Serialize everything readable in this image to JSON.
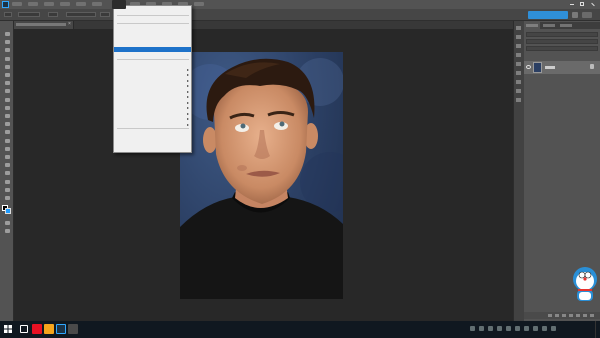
{
  "app": {
    "name": "Adobe Photoshop",
    "logo_text": "Ps",
    "accent": "#31a8ff"
  },
  "menubar": {
    "items": [
      "",
      "",
      "",
      "",
      "",
      "",
      "",
      "",
      "",
      "",
      "",
      ""
    ],
    "active_index": 6,
    "window_controls": [
      "minimize-icon",
      "maximize-icon",
      "close-icon"
    ]
  },
  "options_bar": {
    "cloud_button_label": ""
  },
  "document": {
    "tab_title": "",
    "close_glyph": "×"
  },
  "dropdown": {
    "items": [
      {
        "label": "",
        "shortcut": "",
        "submenu": false
      },
      {
        "separator": true
      },
      {
        "label": "",
        "shortcut": "",
        "submenu": false
      },
      {
        "separator": true
      },
      {
        "label": "",
        "shortcut": "",
        "submenu": false
      },
      {
        "label": "",
        "shortcut": "",
        "submenu": false
      },
      {
        "label": "",
        "shortcut": "",
        "submenu": false
      },
      {
        "label": "",
        "shortcut": "",
        "submenu": false
      },
      {
        "label": "",
        "shortcut": "",
        "submenu": false,
        "highlighted": true
      },
      {
        "label": "",
        "shortcut": "",
        "submenu": false
      },
      {
        "separator": true
      },
      {
        "label": "",
        "shortcut": "",
        "submenu": false
      },
      {
        "label": "",
        "shortcut": "",
        "submenu": true
      },
      {
        "label": "",
        "shortcut": "",
        "submenu": true
      },
      {
        "label": "",
        "shortcut": "",
        "submenu": true
      },
      {
        "label": "",
        "shortcut": "",
        "submenu": true
      },
      {
        "label": "",
        "shortcut": "",
        "submenu": true
      },
      {
        "label": "",
        "shortcut": "",
        "submenu": true
      },
      {
        "label": "",
        "shortcut": "",
        "submenu": true
      },
      {
        "label": "",
        "shortcut": "",
        "submenu": true
      },
      {
        "label": "",
        "shortcut": "",
        "submenu": true
      },
      {
        "label": "",
        "shortcut": "",
        "submenu": true
      },
      {
        "label": "",
        "shortcut": "",
        "submenu": true
      },
      {
        "separator": true
      },
      {
        "label": "",
        "shortcut": "",
        "submenu": false
      }
    ]
  },
  "layers": {
    "items": [
      {
        "name": "",
        "visible": true,
        "locked": true
      }
    ]
  },
  "taskbar": {
    "clock_time": "",
    "clock_date": "",
    "pinned_colors": [
      "#ffffff",
      "#e81123",
      "#f7a51c",
      "#31a8ff",
      "#4a4a4a"
    ]
  },
  "colors": {
    "foreground": "#000000",
    "background": "#1e9bff",
    "menu_highlight": "#1e72c9"
  }
}
